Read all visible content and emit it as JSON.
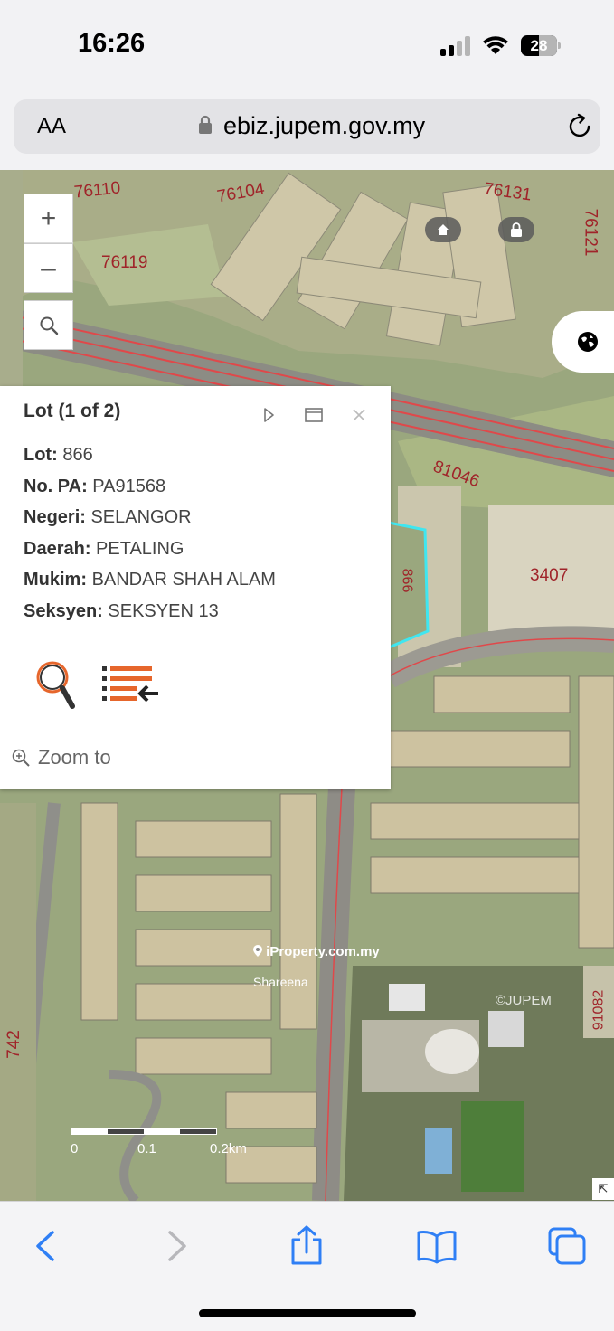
{
  "status_bar": {
    "time": "16:26",
    "battery": "28"
  },
  "browser": {
    "text_size_label": "AA",
    "url": "ebiz.jupem.gov.my"
  },
  "map": {
    "lot_labels": [
      "76110",
      "76104",
      "76131",
      "76121",
      "76119",
      "81046",
      "3407",
      "866",
      "742",
      "91082"
    ],
    "watermark": "iProperty.com.my",
    "watermark_sub": "Shareena",
    "copyright": "©JUPEM",
    "scale_labels": [
      "0",
      "0.1",
      "0.2km"
    ],
    "controls": {
      "zoom_in": "+",
      "zoom_out": "–"
    },
    "colors": {
      "parcel_highlight": "#3fe6f0",
      "road_line": "#e0484a",
      "lot_text": "#a0242a"
    }
  },
  "popup": {
    "title": "Lot (1 of 2)",
    "fields": [
      {
        "key": "Lot:",
        "value": "866"
      },
      {
        "key": "No. PA:",
        "value": "PA91568"
      },
      {
        "key": "Negeri:",
        "value": "SELANGOR"
      },
      {
        "key": "Daerah:",
        "value": "PETALING"
      },
      {
        "key": "Mukim:",
        "value": "BANDAR SHAH ALAM"
      },
      {
        "key": "Seksyen:",
        "value": "SEKSYEN 13"
      }
    ],
    "zoom_to": "Zoom to",
    "colors": {
      "list_icon": "#e6662c"
    }
  }
}
